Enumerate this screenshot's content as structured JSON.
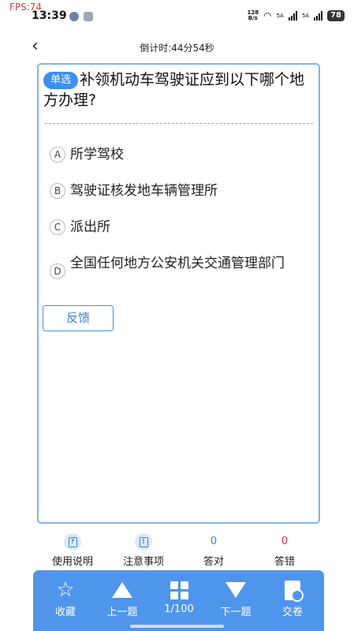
{
  "overlay": {
    "fps": "FPS:74"
  },
  "status_bar": {
    "time": "13:39",
    "net_speed_top": "128",
    "net_speed_bottom": "B/s",
    "sig1": "5A",
    "sig2": "5A",
    "battery": "78"
  },
  "header": {
    "timer": "倒计时:44分54秒"
  },
  "question": {
    "type_tag": "单选",
    "text": "补领机动车驾驶证应到以下哪个地方办理?",
    "options": [
      {
        "letter": "A",
        "text": "所学驾校"
      },
      {
        "letter": "B",
        "text": "驾驶证核发地车辆管理所"
      },
      {
        "letter": "C",
        "text": "派出所"
      },
      {
        "letter": "D",
        "text": "全国任何地方公安机关交通管理部门"
      }
    ],
    "feedback_label": "反馈"
  },
  "stats": {
    "help_label": "使用说明",
    "notes_label": "注意事项",
    "correct_count": "0",
    "correct_label": "答对",
    "wrong_count": "0",
    "wrong_label": "答错"
  },
  "toolbar": {
    "favorite_label": "收藏",
    "prev_label": "上一题",
    "progress_label": "1/100",
    "next_label": "下一题",
    "submit_label": "交卷"
  },
  "colors": {
    "accent": "#4f95ec",
    "wrong_count": "#c0392b",
    "correct_count": "#3a7fd6"
  }
}
